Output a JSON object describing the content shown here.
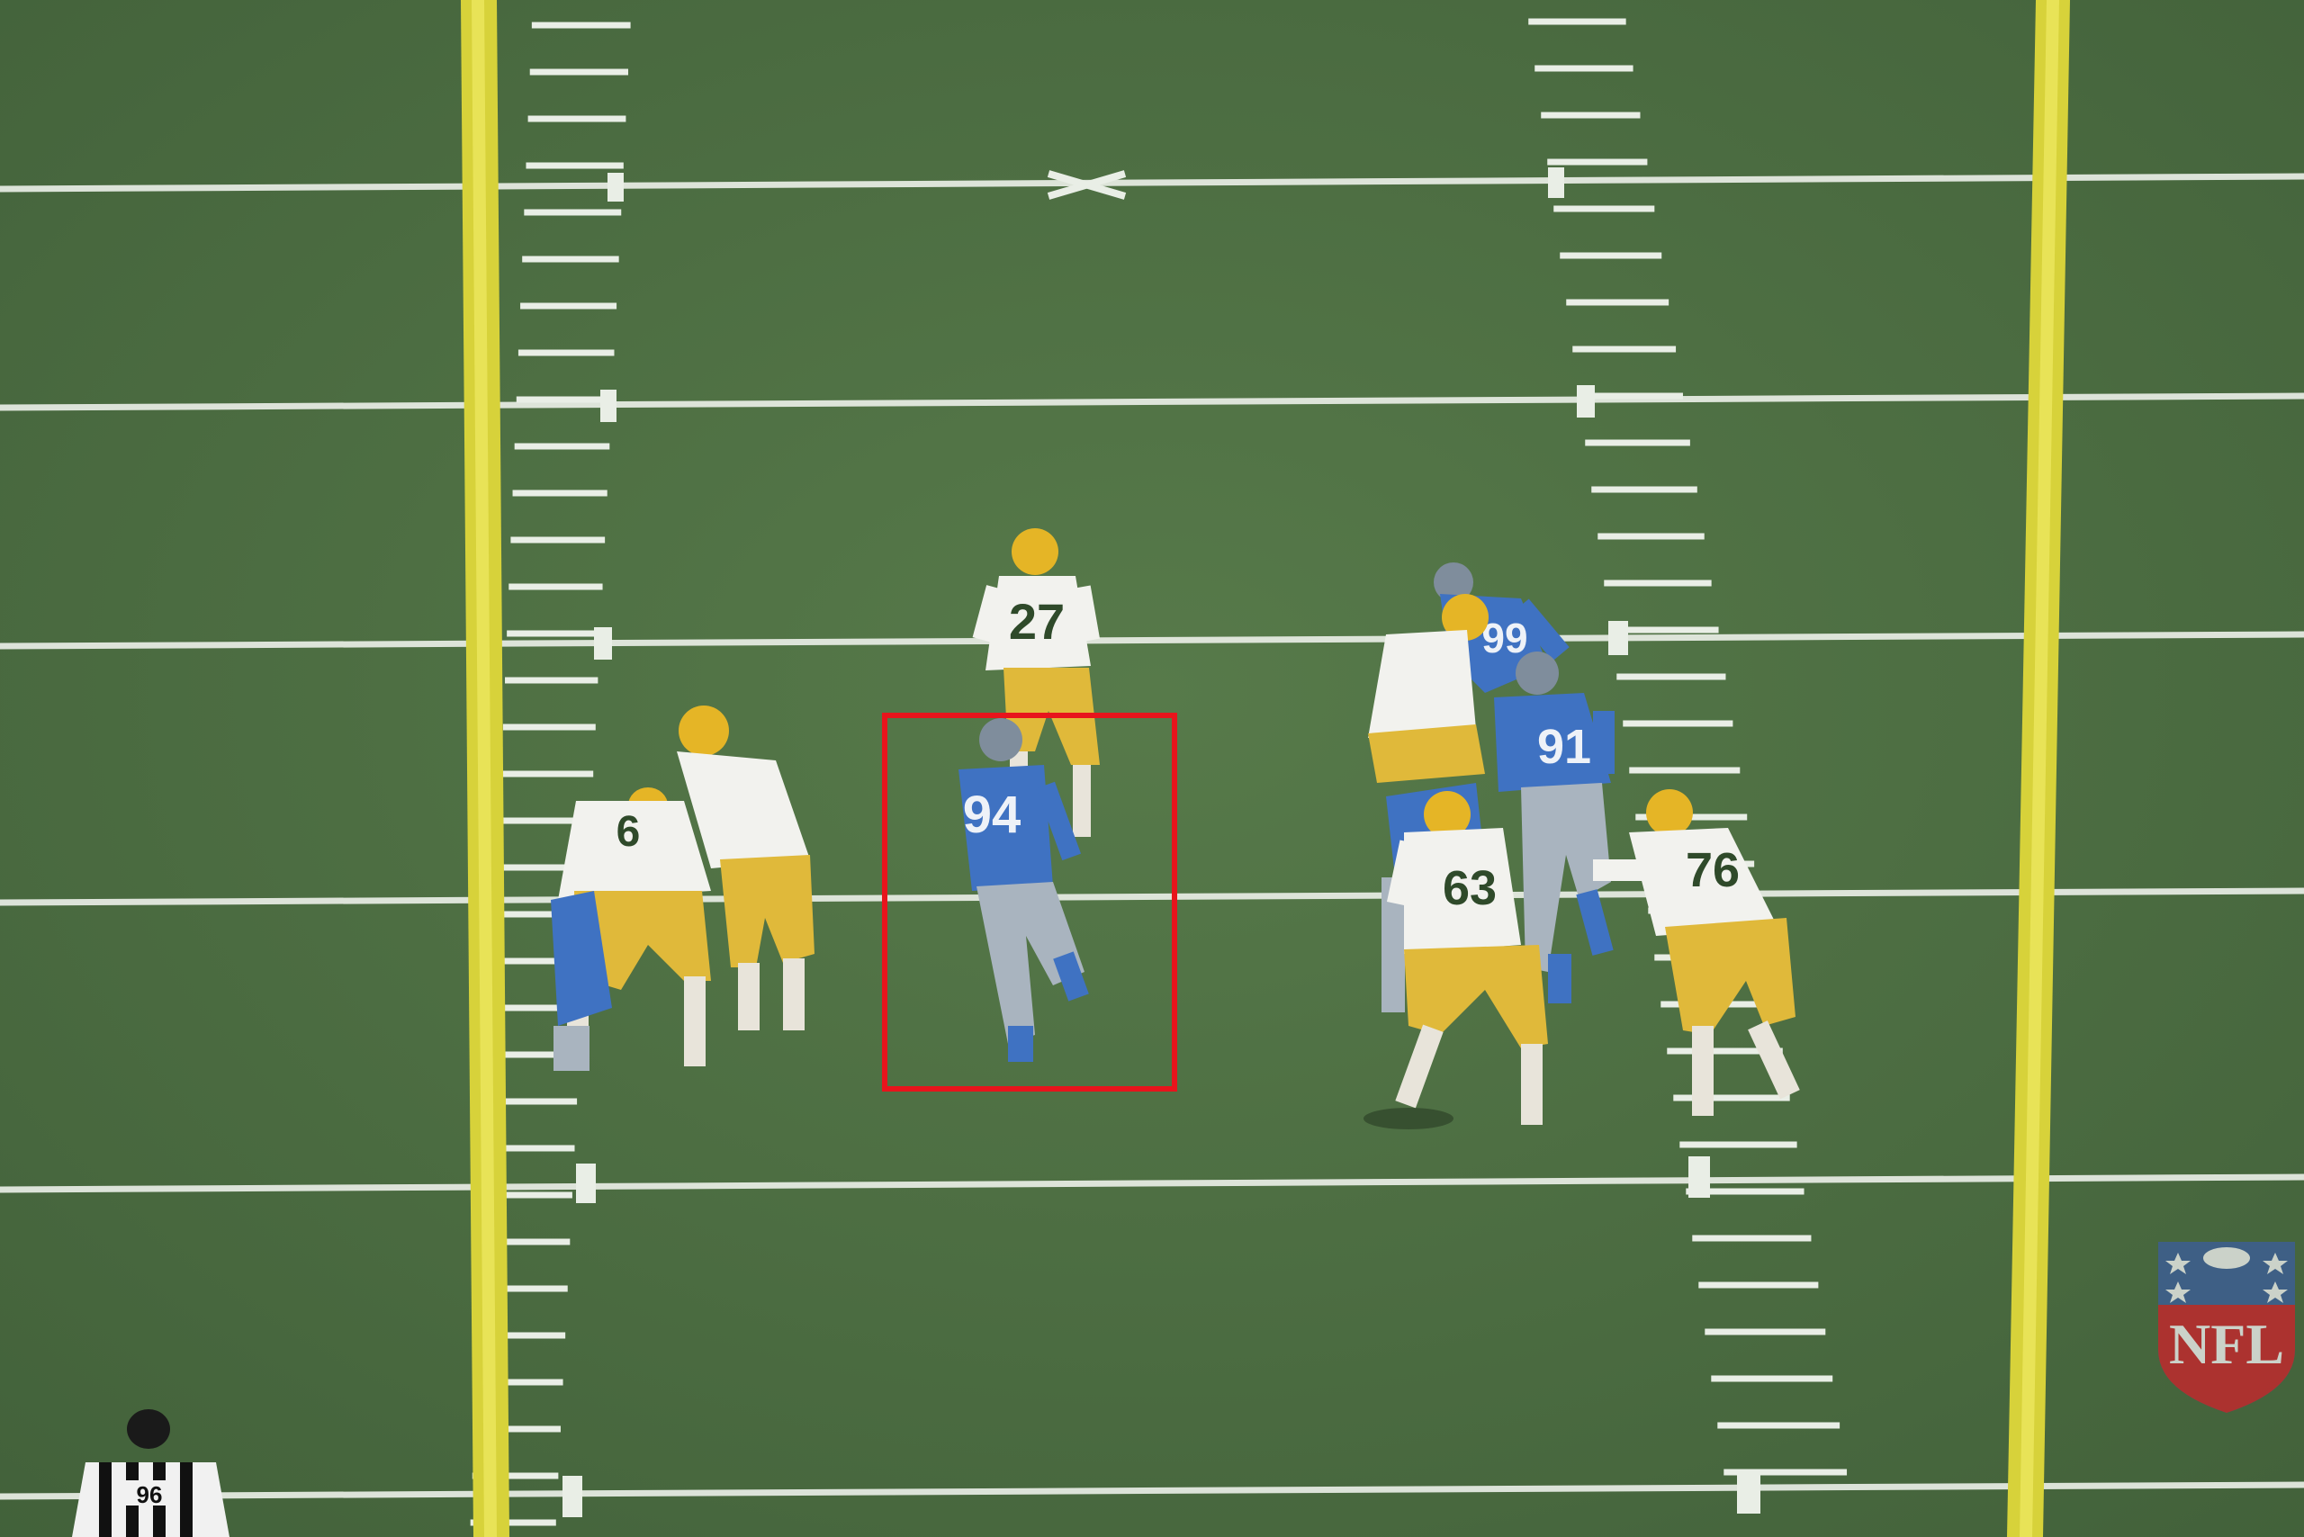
{
  "scene": {
    "colors": {
      "turf": "#4e6e42",
      "turf_dark": "#3f5d36",
      "field_line": "#e9eee6",
      "goalpost": "#d7d23a",
      "home_jersey": "#3f72c2",
      "home_pants": "#a9b4bf",
      "away_jersey": "#f2f2ee",
      "away_pants": "#e0b93a",
      "helmet_away": "#e5b526",
      "highlight": "#e8141c",
      "shield_blue": "#3c5e9a",
      "shield_red": "#c9242c"
    },
    "players": [
      {
        "number": "27",
        "team": "away"
      },
      {
        "number": "94",
        "team": "home",
        "highlighted": true
      },
      {
        "number": "6",
        "team": "away"
      },
      {
        "number": "91",
        "team": "home"
      },
      {
        "number": "63",
        "team": "away"
      },
      {
        "number": "76",
        "team": "away"
      },
      {
        "number": "99",
        "team": "home"
      }
    ],
    "referee_number": "96",
    "watermark": "NFL"
  }
}
